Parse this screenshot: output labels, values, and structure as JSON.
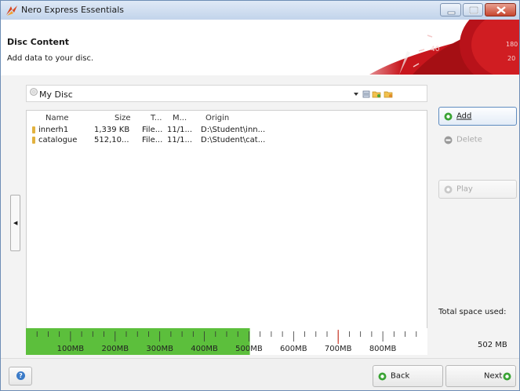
{
  "window": {
    "title": "Nero Express Essentials"
  },
  "header": {
    "title": "Disc Content",
    "subtitle": "Add data to your disc."
  },
  "disc": {
    "name": "My Disc"
  },
  "file_list": {
    "columns": [
      "Name",
      "Size",
      "T...",
      "M...",
      "Origin"
    ],
    "rows": [
      {
        "name": "innerh1",
        "size": "1,339 KB",
        "type": "File...",
        "modified": "11/1...",
        "origin": "D:\\Student\\inn..."
      },
      {
        "name": "catalogue",
        "size": "512,10...",
        "type": "File...",
        "modified": "11/1...",
        "origin": "D:\\Student\\cat..."
      }
    ]
  },
  "buttons": {
    "add": "Add",
    "delete": "Delete",
    "play": "Play",
    "back": "Back",
    "next": "Next"
  },
  "capacity": {
    "used_mb": 502,
    "max_mb": 900,
    "ticks": [
      "100MB",
      "200MB",
      "300MB",
      "400MB",
      "500MB",
      "600MB",
      "700MB",
      "800MB"
    ],
    "fill_color": "#5cbf3c",
    "marker_color": "#d04030"
  },
  "total_space": {
    "label": "Total space used:",
    "value": "502 MB"
  },
  "colors": {
    "accent": "#3b7bc8",
    "header_red": "#c8161d",
    "ok_green": "#3aa335"
  }
}
